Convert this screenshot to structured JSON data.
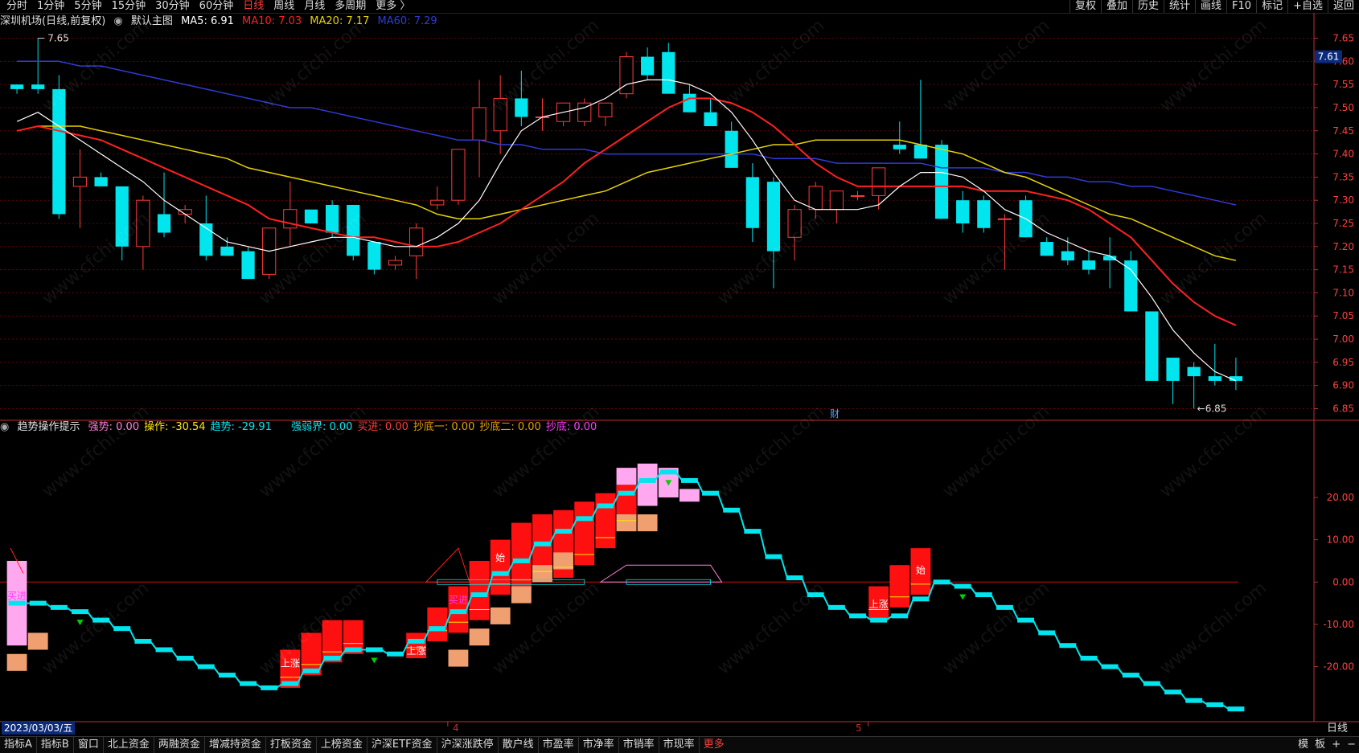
{
  "toolbar": {
    "periods": [
      "分时",
      "1分钟",
      "5分钟",
      "15分钟",
      "30分钟",
      "60分钟",
      "日线",
      "周线",
      "月线",
      "多周期",
      "更多 〉"
    ],
    "active_period": "日线",
    "right_buttons": [
      "复权",
      "叠加",
      "历史",
      "统计",
      "画线",
      "F10",
      "+自选",
      "返回"
    ],
    "right_extra": "标记"
  },
  "main_legend": {
    "stock": "深圳机场(日线,前复权)",
    "chart_name": "默认主图",
    "ma5": "MA5: 6.91",
    "ma10": "MA10: 7.03",
    "ma20": "MA20: 7.17",
    "ma60": "MA60: 7.29"
  },
  "colors": {
    "up": "#ff3b3b",
    "down": "#00e5ee",
    "ma5": "#ffffff",
    "ma10": "#ff2020",
    "ma20": "#e6d200",
    "ma60": "#2f3bd6",
    "grid": "#6b0000",
    "axis": "#c03030"
  },
  "price_axis": {
    "ticks": [
      "7.65",
      "7.60",
      "7.55",
      "7.50",
      "7.45",
      "7.40",
      "7.35",
      "7.30",
      "7.25",
      "7.20",
      "7.15",
      "7.10",
      "7.05",
      "7.00",
      "6.95",
      "6.90",
      "6.85"
    ],
    "current": "7.61",
    "high_label": "7.65",
    "low_label": "6.85",
    "fin_label": "财"
  },
  "indicator": {
    "name": "趋势操作提示",
    "items": [
      {
        "label": "强势: 0.00",
        "color": "#ff7ad6"
      },
      {
        "label": "操作: -30.54",
        "color": "#ffe600"
      },
      {
        "label": "趋势: -29.91",
        "color": "#00e5ee"
      },
      {
        "label": "强弱界: 0.00",
        "color": "#00e5ee"
      },
      {
        "label": "买进: 0.00",
        "color": "#ff3b3b"
      },
      {
        "label": "抄底一: 0.00",
        "color": "#e6a200"
      },
      {
        "label": "抄底二: 0.00",
        "color": "#e6a200"
      },
      {
        "label": "抄底: 0.00",
        "color": "#ff3bff"
      }
    ],
    "axis_ticks": [
      "20.00",
      "10.00",
      "0.00",
      "-10.00",
      "-20.00"
    ],
    "labels": {
      "buy": "买进",
      "rise": "上涨",
      "start": "始"
    }
  },
  "chart_data": [
    {
      "type": "candlestick",
      "title": "深圳机场(日线,前复权)",
      "ylim": [
        6.83,
        7.67
      ],
      "candles": [
        [
          7.55,
          7.55,
          7.53,
          7.54
        ],
        [
          7.55,
          7.65,
          7.53,
          7.54
        ],
        [
          7.54,
          7.57,
          7.26,
          7.27
        ],
        [
          7.33,
          7.41,
          7.24,
          7.35
        ],
        [
          7.35,
          7.36,
          7.33,
          7.33
        ],
        [
          7.33,
          7.33,
          7.17,
          7.2
        ],
        [
          7.2,
          7.31,
          7.15,
          7.3
        ],
        [
          7.27,
          7.36,
          7.22,
          7.23
        ],
        [
          7.27,
          7.29,
          7.25,
          7.28
        ],
        [
          7.25,
          7.31,
          7.17,
          7.18
        ],
        [
          7.2,
          7.22,
          7.18,
          7.18
        ],
        [
          7.19,
          7.2,
          7.13,
          7.13
        ],
        [
          7.14,
          7.23,
          7.13,
          7.24
        ],
        [
          7.24,
          7.34,
          7.2,
          7.28
        ],
        [
          7.28,
          7.28,
          7.26,
          7.25
        ],
        [
          7.29,
          7.3,
          7.22,
          7.23
        ],
        [
          7.29,
          7.29,
          7.17,
          7.18
        ],
        [
          7.21,
          7.21,
          7.14,
          7.15
        ],
        [
          7.16,
          7.18,
          7.15,
          7.17
        ],
        [
          7.18,
          7.25,
          7.13,
          7.24
        ],
        [
          7.29,
          7.33,
          7.28,
          7.3
        ],
        [
          7.3,
          7.41,
          7.29,
          7.41
        ],
        [
          7.43,
          7.56,
          7.35,
          7.5
        ],
        [
          7.45,
          7.57,
          7.4,
          7.52
        ],
        [
          7.52,
          7.58,
          7.46,
          7.48
        ],
        [
          7.48,
          7.52,
          7.45,
          7.48
        ],
        [
          7.47,
          7.51,
          7.46,
          7.51
        ],
        [
          7.47,
          7.52,
          7.46,
          7.51
        ],
        [
          7.48,
          7.51,
          7.46,
          7.51
        ],
        [
          7.53,
          7.62,
          7.52,
          7.61
        ],
        [
          7.61,
          7.63,
          7.56,
          7.57
        ],
        [
          7.62,
          7.64,
          7.53,
          7.53
        ],
        [
          7.53,
          7.55,
          7.49,
          7.49
        ],
        [
          7.49,
          7.52,
          7.46,
          7.46
        ],
        [
          7.45,
          7.47,
          7.37,
          7.37
        ],
        [
          7.35,
          7.38,
          7.21,
          7.24
        ],
        [
          7.34,
          7.35,
          7.11,
          7.19
        ],
        [
          7.22,
          7.29,
          7.17,
          7.28
        ],
        [
          7.28,
          7.34,
          7.26,
          7.33
        ],
        [
          7.28,
          7.32,
          7.25,
          7.32
        ],
        [
          7.31,
          7.32,
          7.3,
          7.31
        ],
        [
          7.31,
          7.37,
          7.28,
          7.37
        ],
        [
          7.42,
          7.47,
          7.4,
          7.41
        ],
        [
          7.42,
          7.56,
          7.39,
          7.39
        ],
        [
          7.42,
          7.43,
          7.26,
          7.26
        ],
        [
          7.3,
          7.32,
          7.23,
          7.25
        ],
        [
          7.3,
          7.31,
          7.23,
          7.24
        ],
        [
          7.26,
          7.27,
          7.15,
          7.26
        ],
        [
          7.3,
          7.31,
          7.22,
          7.22
        ],
        [
          7.21,
          7.22,
          7.19,
          7.18
        ],
        [
          7.19,
          7.22,
          7.16,
          7.17
        ],
        [
          7.17,
          7.19,
          7.14,
          7.15
        ],
        [
          7.18,
          7.22,
          7.11,
          7.17
        ],
        [
          7.17,
          7.19,
          7.06,
          7.06
        ],
        [
          7.06,
          7.06,
          6.91,
          6.91
        ],
        [
          6.96,
          6.96,
          6.86,
          6.91
        ],
        [
          6.94,
          6.95,
          6.85,
          6.92
        ],
        [
          6.92,
          6.99,
          6.9,
          6.91
        ],
        [
          6.92,
          6.96,
          6.89,
          6.91
        ]
      ],
      "ma5": [
        7.47,
        7.49,
        7.46,
        7.43,
        7.4,
        7.37,
        7.34,
        7.3,
        7.27,
        7.24,
        7.21,
        7.2,
        7.19,
        7.2,
        7.21,
        7.22,
        7.22,
        7.21,
        7.2,
        7.2,
        7.22,
        7.25,
        7.3,
        7.38,
        7.45,
        7.48,
        7.49,
        7.5,
        7.52,
        7.55,
        7.56,
        7.56,
        7.55,
        7.53,
        7.49,
        7.43,
        7.36,
        7.3,
        7.28,
        7.28,
        7.28,
        7.29,
        7.33,
        7.36,
        7.36,
        7.35,
        7.32,
        7.28,
        7.26,
        7.23,
        7.21,
        7.19,
        7.18,
        7.15,
        7.09,
        7.02,
        6.97,
        6.93,
        6.91
      ],
      "ma10": [
        7.45,
        7.46,
        7.45,
        7.44,
        7.43,
        7.41,
        7.39,
        7.37,
        7.35,
        7.33,
        7.31,
        7.29,
        7.26,
        7.25,
        7.24,
        7.23,
        7.22,
        7.22,
        7.21,
        7.2,
        7.2,
        7.21,
        7.23,
        7.25,
        7.28,
        7.31,
        7.34,
        7.38,
        7.41,
        7.44,
        7.47,
        7.5,
        7.52,
        7.52,
        7.51,
        7.49,
        7.46,
        7.42,
        7.38,
        7.35,
        7.33,
        7.33,
        7.33,
        7.33,
        7.33,
        7.33,
        7.32,
        7.32,
        7.32,
        7.31,
        7.3,
        7.28,
        7.25,
        7.22,
        7.17,
        7.12,
        7.08,
        7.05,
        7.03
      ],
      "ma20": [
        7.45,
        7.46,
        7.46,
        7.46,
        7.45,
        7.44,
        7.43,
        7.42,
        7.41,
        7.4,
        7.39,
        7.37,
        7.36,
        7.35,
        7.34,
        7.33,
        7.32,
        7.31,
        7.3,
        7.29,
        7.27,
        7.26,
        7.26,
        7.27,
        7.28,
        7.29,
        7.3,
        7.31,
        7.32,
        7.34,
        7.36,
        7.37,
        7.38,
        7.39,
        7.4,
        7.41,
        7.42,
        7.42,
        7.43,
        7.43,
        7.43,
        7.43,
        7.43,
        7.42,
        7.41,
        7.4,
        7.38,
        7.36,
        7.35,
        7.33,
        7.31,
        7.29,
        7.27,
        7.26,
        7.24,
        7.22,
        7.2,
        7.18,
        7.17
      ],
      "ma60": [
        7.6,
        7.6,
        7.6,
        7.59,
        7.59,
        7.58,
        7.57,
        7.56,
        7.55,
        7.54,
        7.53,
        7.52,
        7.51,
        7.5,
        7.5,
        7.49,
        7.48,
        7.47,
        7.46,
        7.45,
        7.44,
        7.43,
        7.43,
        7.42,
        7.42,
        7.41,
        7.41,
        7.41,
        7.4,
        7.4,
        7.4,
        7.4,
        7.4,
        7.4,
        7.4,
        7.4,
        7.39,
        7.39,
        7.39,
        7.38,
        7.38,
        7.38,
        7.38,
        7.38,
        7.37,
        7.37,
        7.37,
        7.36,
        7.36,
        7.35,
        7.35,
        7.34,
        7.34,
        7.33,
        7.33,
        7.32,
        7.31,
        7.3,
        7.29
      ]
    },
    {
      "type": "bar",
      "title": "趋势操作提示",
      "ylim": [
        -33,
        35
      ],
      "trend": [
        -5,
        -5,
        -6,
        -7,
        -9,
        -11,
        -14,
        -16,
        -18,
        -20,
        -22,
        -24,
        -25,
        -24,
        -21,
        -18,
        -16,
        -16,
        -17,
        -14,
        -11,
        -7,
        -3,
        2,
        5,
        9,
        12,
        15,
        18,
        21,
        24,
        26,
        24,
        21,
        17,
        12,
        6,
        1,
        -3,
        -6,
        -8,
        -9,
        -8,
        -4,
        0,
        -1,
        -3,
        -6,
        -9,
        -12,
        -15,
        -18,
        -20,
        -22,
        -24,
        -26,
        -28,
        -29,
        -30
      ],
      "red_bars": [
        [
          13,
          -25,
          -16
        ],
        [
          14,
          -22,
          -12
        ],
        [
          15,
          -19,
          -9
        ],
        [
          16,
          -17,
          -9
        ],
        [
          19,
          -18,
          -12
        ],
        [
          20,
          -14,
          -6
        ],
        [
          21,
          -12,
          -1
        ],
        [
          22,
          -9,
          5
        ],
        [
          23,
          -3,
          10
        ],
        [
          24,
          -2,
          14
        ],
        [
          25,
          0,
          16
        ],
        [
          26,
          1,
          17
        ],
        [
          27,
          4,
          19
        ],
        [
          28,
          8,
          21
        ],
        [
          29,
          12,
          23
        ],
        [
          41,
          -9,
          -1
        ],
        [
          42,
          -6,
          4
        ],
        [
          43,
          -3,
          8
        ]
      ],
      "pink_bars": [
        [
          0,
          -15,
          5
        ],
        [
          29,
          14,
          27
        ],
        [
          30,
          18,
          28
        ],
        [
          31,
          20,
          27
        ],
        [
          32,
          19,
          22
        ]
      ],
      "orange_bars": [
        [
          0,
          -21,
          -17
        ],
        [
          1,
          -16,
          -12
        ],
        [
          21,
          -20,
          -16
        ],
        [
          22,
          -15,
          -11
        ],
        [
          23,
          -10,
          -6
        ],
        [
          24,
          -5,
          -1
        ],
        [
          25,
          0,
          4
        ],
        [
          26,
          3,
          7
        ],
        [
          29,
          12,
          16
        ],
        [
          30,
          12,
          16
        ]
      ],
      "buy_labels": [
        0,
        21
      ],
      "rise_labels": [
        13,
        19,
        41
      ],
      "start_labels": [
        23,
        43
      ]
    }
  ],
  "x_dates": {
    "current": "2023/03/03/五",
    "m4": "4",
    "m5": "5"
  },
  "bottom_tabs": [
    "指标A",
    "指标B",
    "窗口",
    "北上资金",
    "两融资金",
    "增减持资金",
    "打板资金",
    "上榜资金",
    "沪深ETF资金",
    "沪深涨跌停",
    "散户线",
    "市盈率",
    "市净率",
    "市销率",
    "市现率",
    "更多"
  ],
  "bottom_right": [
    "模",
    "板",
    "+",
    "−"
  ],
  "period_label": "日线",
  "watermark": "www.cfchi.com"
}
